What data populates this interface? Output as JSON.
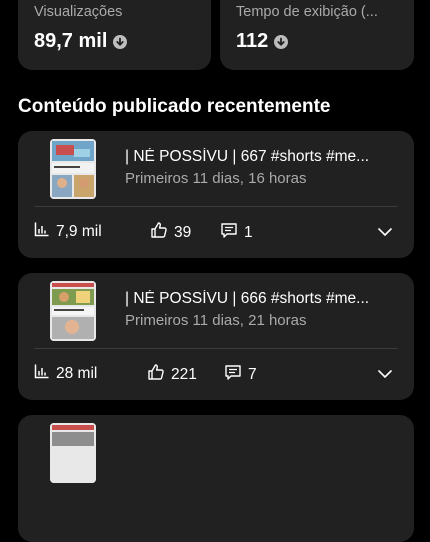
{
  "stats": [
    {
      "label": "Visualizações",
      "value": "89,7 mil"
    },
    {
      "label": "Tempo de exibição (...",
      "value": "112"
    }
  ],
  "section_title": "Conteúdo publicado recentemente",
  "videos": [
    {
      "title": "| NÉ POSSÍVU | 667 #shorts #me...",
      "subtitle": "Primeiros 11 dias, 16 horas",
      "views": "7,9 mil",
      "likes": "39",
      "comments": "1"
    },
    {
      "title": "| NÉ POSSÍVU | 666 #shorts #me...",
      "subtitle": "Primeiros 11 dias, 21 horas",
      "views": "28 mil",
      "likes": "221",
      "comments": "7"
    }
  ],
  "colors": {
    "background": "#000000",
    "card": "#212121",
    "text_primary": "#ffffff",
    "text_secondary": "#aaaaaa"
  }
}
